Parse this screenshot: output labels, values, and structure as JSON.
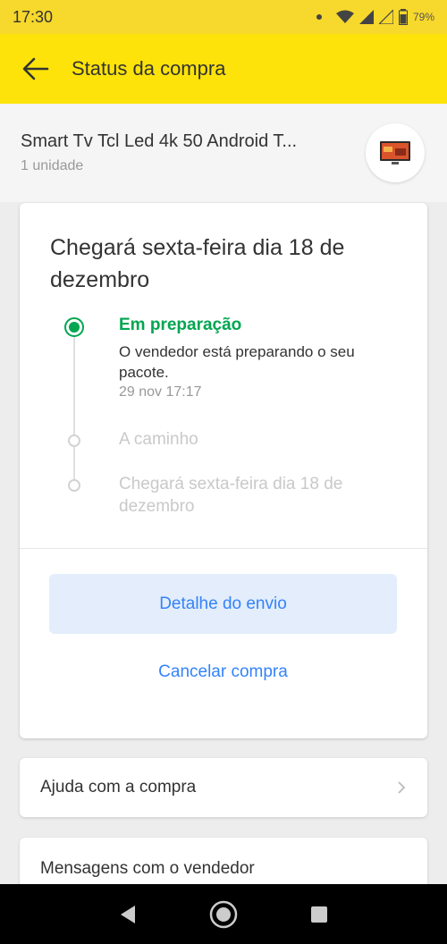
{
  "status_bar": {
    "time": "17:30",
    "battery": "79%"
  },
  "header": {
    "title": "Status da compra"
  },
  "product": {
    "name": "Smart Tv Tcl Led 4k 50  Android T...",
    "quantity": "1 unidade"
  },
  "status_card": {
    "title": "Chegará sexta-feira dia 18 de dezembro",
    "steps": [
      {
        "title": "Em preparação",
        "description": "O vendedor está preparando o seu pacote.",
        "date": "29 nov 17:17",
        "active": true
      },
      {
        "title": "A caminho",
        "active": false
      },
      {
        "title": "Chegará sexta-feira dia 18 de dezembro",
        "active": false
      }
    ],
    "detail_button": "Detalhe do envio",
    "cancel_button": "Cancelar compra"
  },
  "help": {
    "label": "Ajuda com a compra"
  },
  "messages": {
    "label": "Mensagens com o vendedor"
  },
  "colors": {
    "brand_yellow": "#fde30a",
    "accent_blue": "#3483fa",
    "success_green": "#00a650"
  }
}
